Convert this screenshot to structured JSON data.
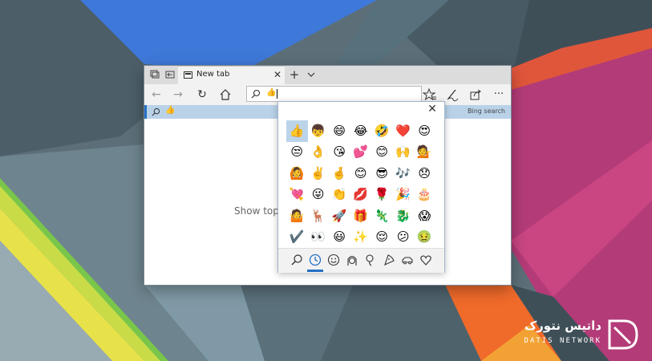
{
  "colors": {
    "accent": "#2470c5",
    "selection": "#bcd4ea",
    "suggestion_bg": "#b9d2e8"
  },
  "browser": {
    "tab": {
      "title": "New tab",
      "icon": "newtab-page-icon"
    },
    "address": {
      "emoji": "👍"
    },
    "suggestion": {
      "emoji": "👍",
      "provider": "Bing search"
    },
    "page_text": "Show top s"
  },
  "emoji_panel": {
    "rows": [
      [
        "👍",
        "👦",
        "😄",
        "😂",
        "🤣",
        "❤️",
        "😍"
      ],
      [
        "😒",
        "👌",
        "😘",
        "💕",
        "😊",
        "🙌",
        "💁"
      ],
      [
        "🙆",
        "✌️",
        "🤞",
        "😊",
        "😎",
        "🎶",
        "😞"
      ],
      [
        "💘",
        "😜",
        "👏",
        "💋",
        "🌹",
        "🎉",
        "🎂"
      ],
      [
        "🤷",
        "🦌",
        "🚀",
        "🎁",
        "🦎",
        "🐉",
        "😱"
      ],
      [
        "✔️",
        "👀",
        "😃",
        "✨",
        "😌",
        "😕",
        "🤢"
      ]
    ],
    "selected_emoji": "👍",
    "categories": [
      "search-icon",
      "recent-clock-icon",
      "smiley-face-icon",
      "people-face-icon",
      "celebration-icon",
      "food-icon",
      "car-icon",
      "heart-icon"
    ],
    "active_category": "recent-clock-icon"
  },
  "watermark": {
    "title": "داتیس نتورک",
    "subtitle": "DATIS NETWORK"
  }
}
